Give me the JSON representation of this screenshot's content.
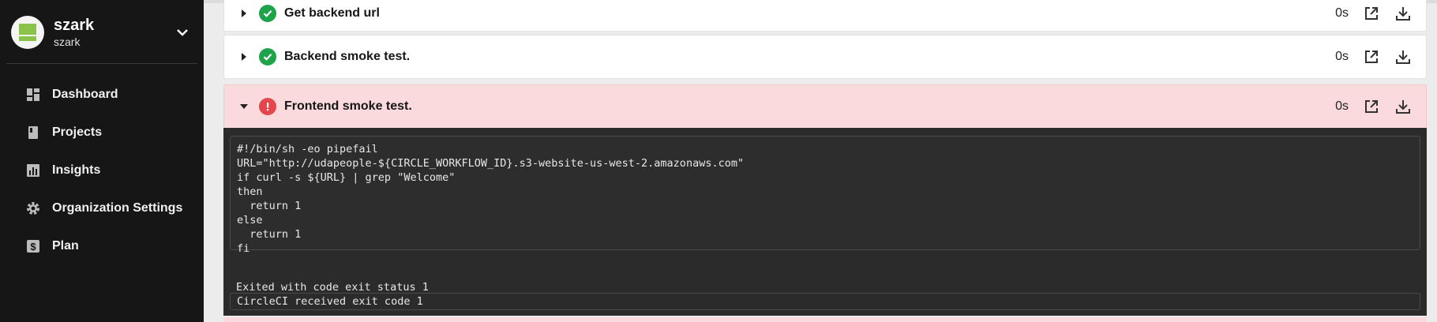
{
  "org": {
    "name": "szark",
    "subtitle": "szark"
  },
  "sidebar": {
    "items": [
      {
        "label": "Dashboard",
        "icon": "dashboard-icon"
      },
      {
        "label": "Projects",
        "icon": "book-icon"
      },
      {
        "label": "Insights",
        "icon": "bar-chart-icon"
      },
      {
        "label": "Organization Settings",
        "icon": "gear-icon"
      },
      {
        "label": "Plan",
        "icon": "dollar-icon"
      }
    ]
  },
  "steps": [
    {
      "title": "Get backend url",
      "duration": "0s",
      "status": "success"
    },
    {
      "title": "Backend smoke test.",
      "duration": "0s",
      "status": "success"
    },
    {
      "title": "Frontend smoke test.",
      "duration": "0s",
      "status": "failed"
    }
  ],
  "output": {
    "code_lines": [
      "#!/bin/sh -eo pipefail",
      "URL=\"http://udapeople-${CIRCLE_WORKFLOW_ID}.s3-website-us-west-2.amazonaws.com\"",
      "if curl -s ${URL} | grep \"Welcome\"",
      "then",
      "  return 1",
      "else",
      "  return 1",
      "fi"
    ],
    "exit_message": "Exited with code exit status 1",
    "received_message": "CircleCI received exit code 1"
  },
  "colors": {
    "success": "#1ea34a",
    "error": "#e5464b",
    "failed_bg": "#fadadd",
    "sidebar_bg": "#161616"
  }
}
